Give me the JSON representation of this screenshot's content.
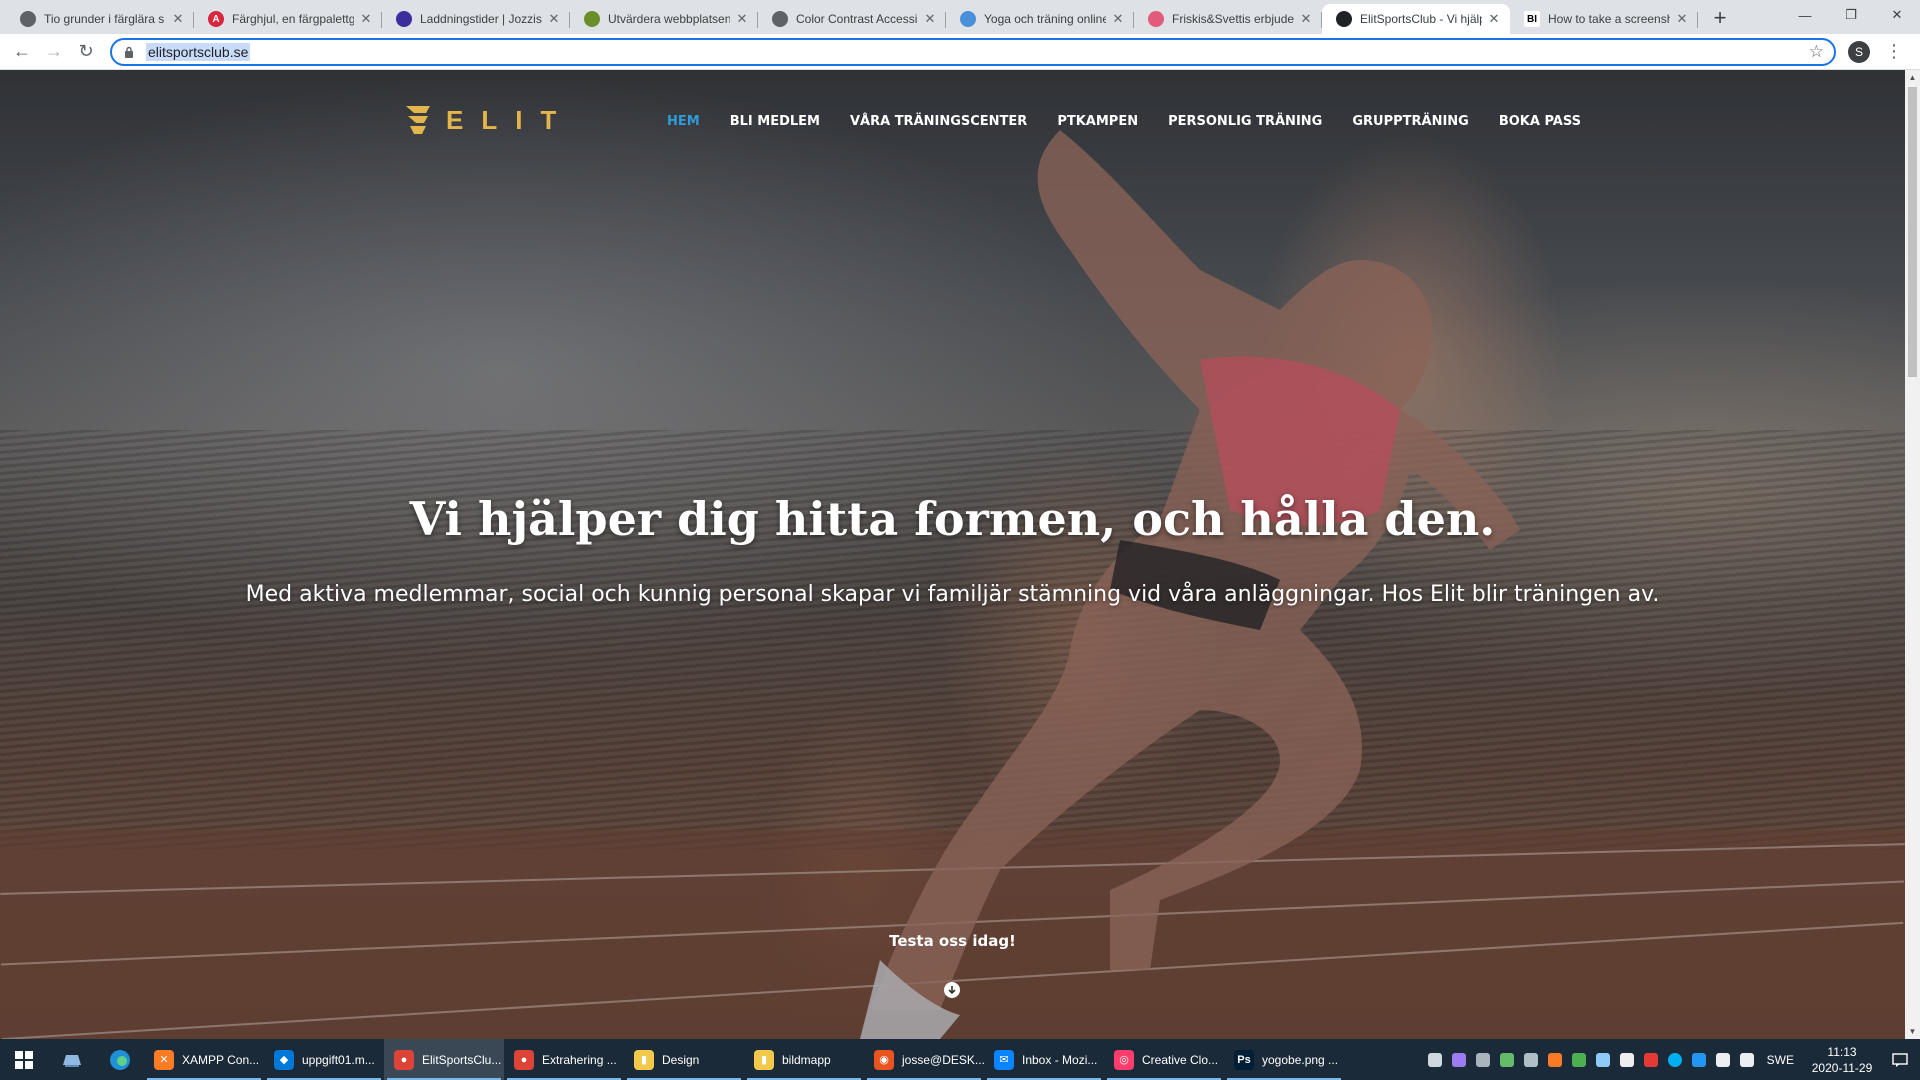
{
  "browser": {
    "tabs": [
      {
        "title": "Tio grunder i färglära s",
        "favicon_color": "#5f6368",
        "favicon_text": ""
      },
      {
        "title": "Färghjul, en färgpalettg",
        "favicon_color": "#d7263d",
        "favicon_text": "A"
      },
      {
        "title": "Laddningstider | Jozzis",
        "favicon_color": "#3b2f9e",
        "favicon_text": ""
      },
      {
        "title": "Utvärdera webbplatsen",
        "favicon_color": "#6a8f2a",
        "favicon_text": ""
      },
      {
        "title": "Color Contrast Accessib",
        "favicon_color": "#5f6368",
        "favicon_text": ""
      },
      {
        "title": "Yoga och träning online",
        "favicon_color": "#4a90d9",
        "favicon_text": ""
      },
      {
        "title": "Friskis&Svettis erbjuder",
        "favicon_color": "#e25b7a",
        "favicon_text": ""
      },
      {
        "title": "ElitSportsClub - Vi hjälp",
        "favicon_color": "#202124",
        "favicon_text": ""
      },
      {
        "title": "How to take a screensh",
        "favicon_color": "#ffffff",
        "favicon_text": "BI"
      }
    ],
    "active_tab_index": 7,
    "url": "elitsportsclub.se",
    "profile_initial": "S",
    "new_tab_glyph": "+",
    "close_glyph": "✕"
  },
  "site": {
    "logo_text": "ELIT",
    "brand_color": "#e4b54a",
    "nav": [
      {
        "label": "HEM",
        "active": true
      },
      {
        "label": "BLI MEDLEM",
        "active": false
      },
      {
        "label": "VÅRA TRÄNINGSCENTER",
        "active": false
      },
      {
        "label": "PTKAMPEN",
        "active": false
      },
      {
        "label": "PERSONLIG TRÄNING",
        "active": false
      },
      {
        "label": "GRUPPTRÄNING",
        "active": false
      },
      {
        "label": "BOKA PASS",
        "active": false
      }
    ],
    "nav_active_color": "#2f9bd9",
    "hero_title": "Vi hjälper dig hitta formen, och hålla den.",
    "hero_subtitle": "Med aktiva medlemmar, social och kunnig personal skapar vi familjär stämning vid våra anläggningar. Hos Elit blir träningen av.",
    "cta_label": "Testa oss idag!"
  },
  "taskbar": {
    "apps": [
      {
        "label": "XAMPP Con...",
        "color": "#fb7a24",
        "glyph": "✕",
        "active": false
      },
      {
        "label": "uppgift01.m...",
        "color": "#0078d7",
        "glyph": "◆",
        "active": false
      },
      {
        "label": "ElitSportsClu...",
        "color": "#db4437",
        "glyph": "●",
        "active": true
      },
      {
        "label": "Extrahering ...",
        "color": "#db4437",
        "glyph": "●",
        "active": false
      },
      {
        "label": "Design",
        "color": "#f2c94c",
        "glyph": "▮",
        "active": false
      },
      {
        "label": "bildmapp",
        "color": "#f2c94c",
        "glyph": "▮",
        "active": false
      },
      {
        "label": "josse@DESK...",
        "color": "#e95420",
        "glyph": "◉",
        "active": false
      },
      {
        "label": "Inbox - Mozi...",
        "color": "#0a84ff",
        "glyph": "✉",
        "active": false
      },
      {
        "label": "Creative Clo...",
        "color": "#ff3d6b",
        "glyph": "◎",
        "active": false
      },
      {
        "label": "yogobe.png ...",
        "color": "#001e36",
        "glyph": "Ps",
        "active": false
      }
    ],
    "language": "SWE",
    "time": "11:13",
    "date": "2020-11-29"
  }
}
